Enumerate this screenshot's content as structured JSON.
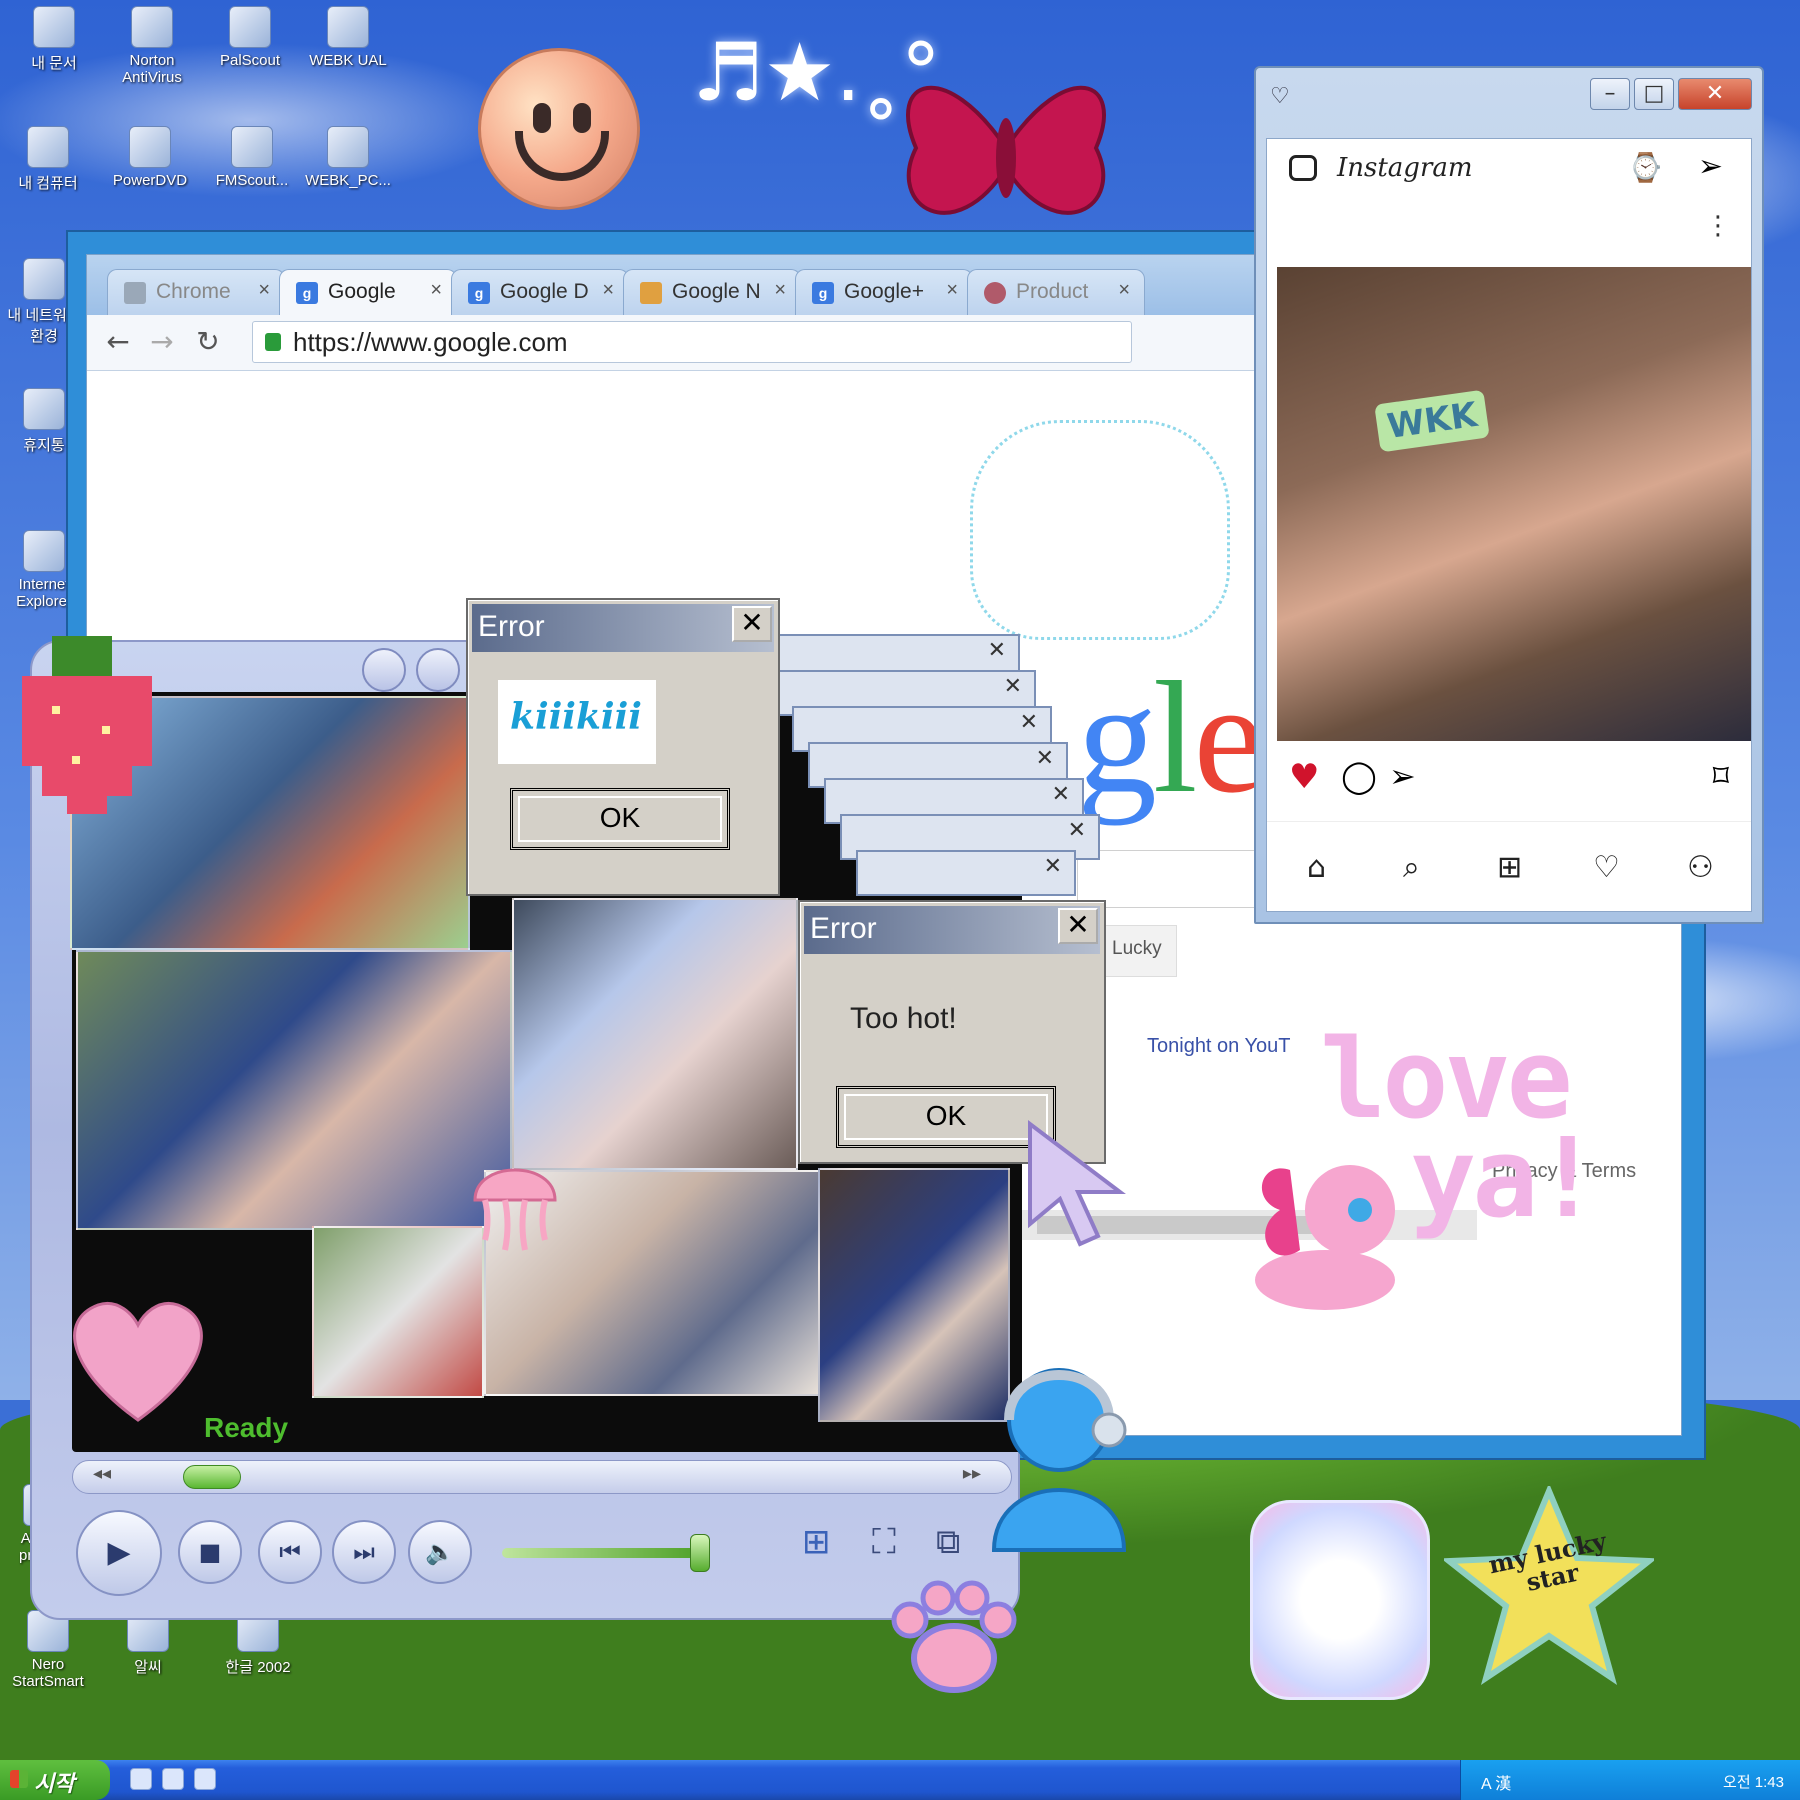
{
  "desktop": {
    "icons_top": [
      {
        "label": "내 문서"
      },
      {
        "label": "Norton AntiVirus"
      },
      {
        "label": "PalScout"
      },
      {
        "label": "WEBK UAL"
      }
    ],
    "icons_row2": [
      {
        "label": "내 컴퓨터"
      },
      {
        "label": "PowerDVD"
      },
      {
        "label": "FMScout..."
      },
      {
        "label": "WEBK_PC..."
      }
    ],
    "icons_left": [
      {
        "label": "내 네트워크 환경"
      },
      {
        "label": "휴지통"
      },
      {
        "label": "Internet Explorer"
      },
      {
        "label": "AVStar premi..."
      }
    ],
    "icons_bottom": [
      {
        "label": "Nero StartSmart"
      },
      {
        "label": "알씨"
      },
      {
        "label": "한글 2002"
      }
    ]
  },
  "taskbar": {
    "start_label": "시작",
    "tray_text": "A 漢",
    "clock": "오전 1:43"
  },
  "chrome": {
    "tabs": [
      {
        "label": "Chrome",
        "favicon": "chrome-icon"
      },
      {
        "label": "Google",
        "favicon": "google-icon"
      },
      {
        "label": "Google D",
        "favicon": "google-icon"
      },
      {
        "label": "Google N",
        "favicon": "google-news-icon"
      },
      {
        "label": "Google+",
        "favicon": "google-icon"
      },
      {
        "label": "Product",
        "favicon": "product-icon"
      }
    ],
    "url": "https://www.google.com",
    "logo_text": "gle",
    "lucky_label": "Lucky",
    "tonight_text": "Tonight on YouT",
    "privacy_text": "Privacy & Terms"
  },
  "instagram": {
    "title": "Instagram",
    "post_sign": "WKK"
  },
  "player": {
    "status": "Ready"
  },
  "errors": [
    {
      "title": "Error",
      "logo_text": "kiiikiii",
      "ok_label": "OK"
    },
    {
      "title": "Error",
      "message": "Too hot!",
      "ok_label": "OK"
    }
  ],
  "stickers": {
    "notes": "♬★.˳°",
    "love_line1": "love",
    "love_line2": "ya!",
    "lucky_star_text": "my lucky star"
  },
  "colors": {
    "xp_blue": "#245edb",
    "start_green": "#3a9b25",
    "google_blue": "#4285f4",
    "google_red": "#ea4335",
    "google_yellow": "#fbbc05",
    "google_green": "#34a853",
    "love_pink": "#f2b4e6"
  }
}
